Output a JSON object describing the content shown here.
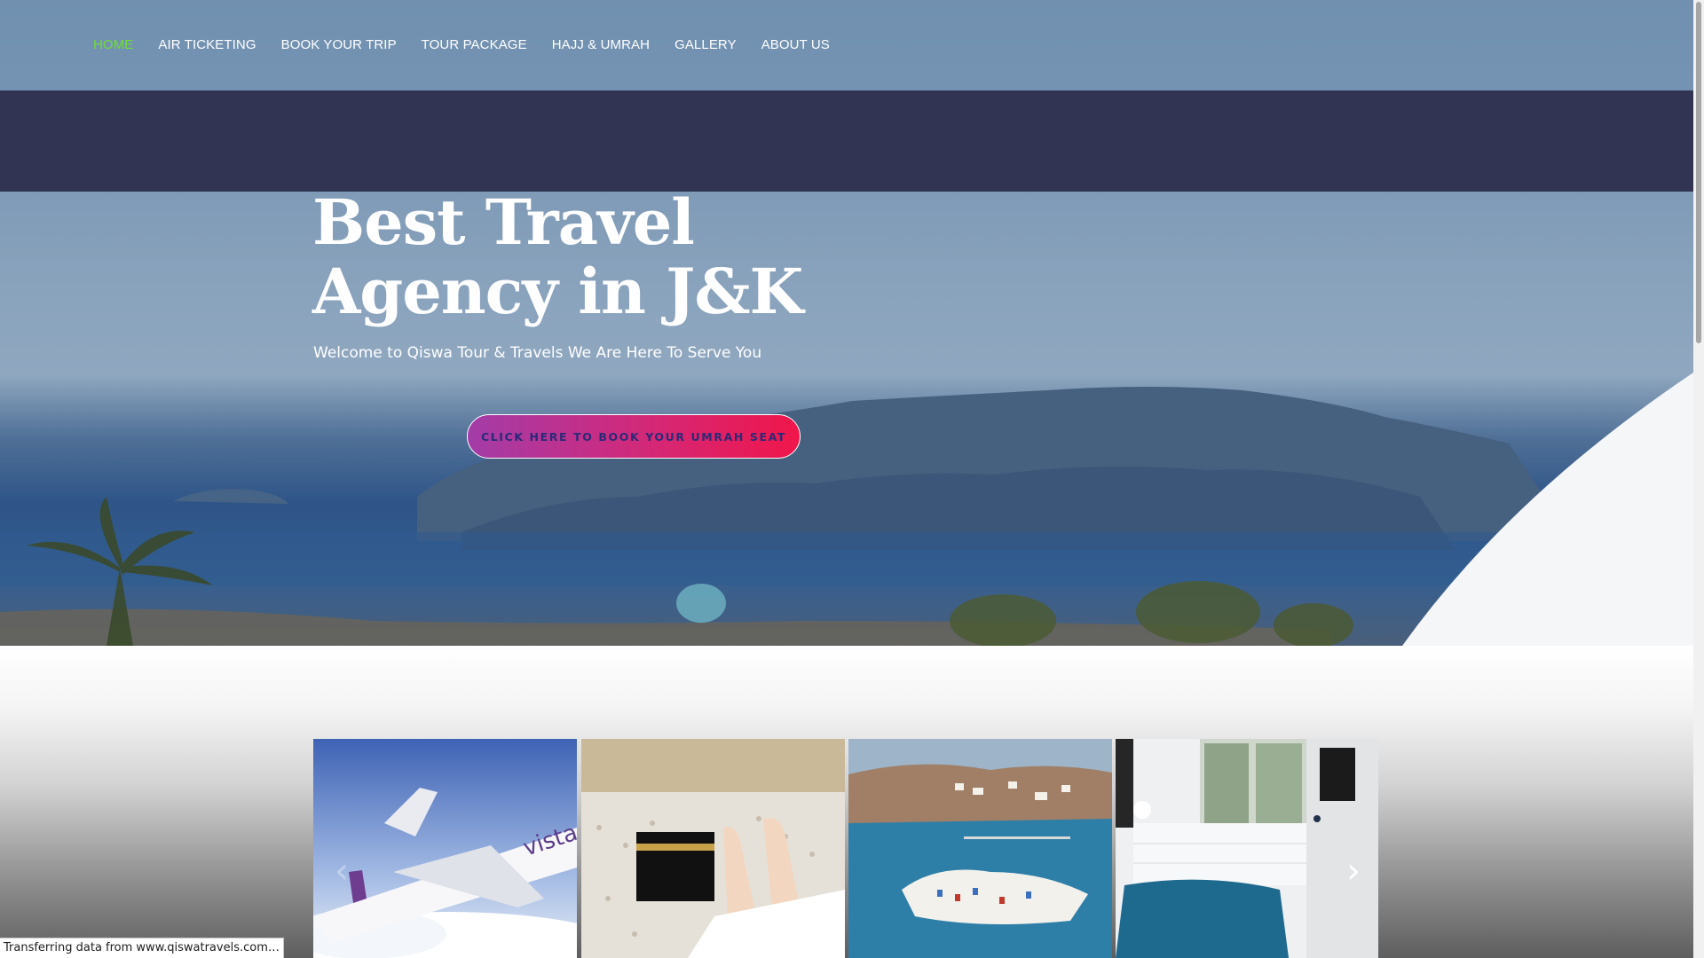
{
  "nav": {
    "items": [
      {
        "label": "HOME",
        "active": true
      },
      {
        "label": "AIR TICKETING",
        "active": false
      },
      {
        "label": "BOOK YOUR TRIP",
        "active": false
      },
      {
        "label": "TOUR PACKAGE",
        "active": false
      },
      {
        "label": "HAJJ & UMRAH",
        "active": false
      },
      {
        "label": "GALLERY",
        "active": false
      },
      {
        "label": "ABOUT US",
        "active": false
      }
    ],
    "active_color": "#6fdc3a"
  },
  "hero": {
    "title": "Best Travel Agency in J&K",
    "subtitle": "Welcome to Qiswa Tour & Travels We Are Here To Serve You",
    "cta_label": "CLICK HERE TO BOOK YOUR UMRAH SEAT"
  },
  "carousel": {
    "slides": [
      {
        "name": "airplane-slide",
        "caption_text": "vista"
      },
      {
        "name": "kaaba-slide"
      },
      {
        "name": "coastal-town-slide"
      },
      {
        "name": "bedroom-slide"
      }
    ],
    "prev_icon": "chevron-left-icon",
    "next_icon": "chevron-right-icon"
  },
  "status_bar": {
    "text": "Transferring data from www.qiswatravels.com…"
  },
  "colors": {
    "dark_band": "#313553",
    "cta_gradient_start": "#a33ca8",
    "cta_gradient_end": "#f0164a"
  }
}
